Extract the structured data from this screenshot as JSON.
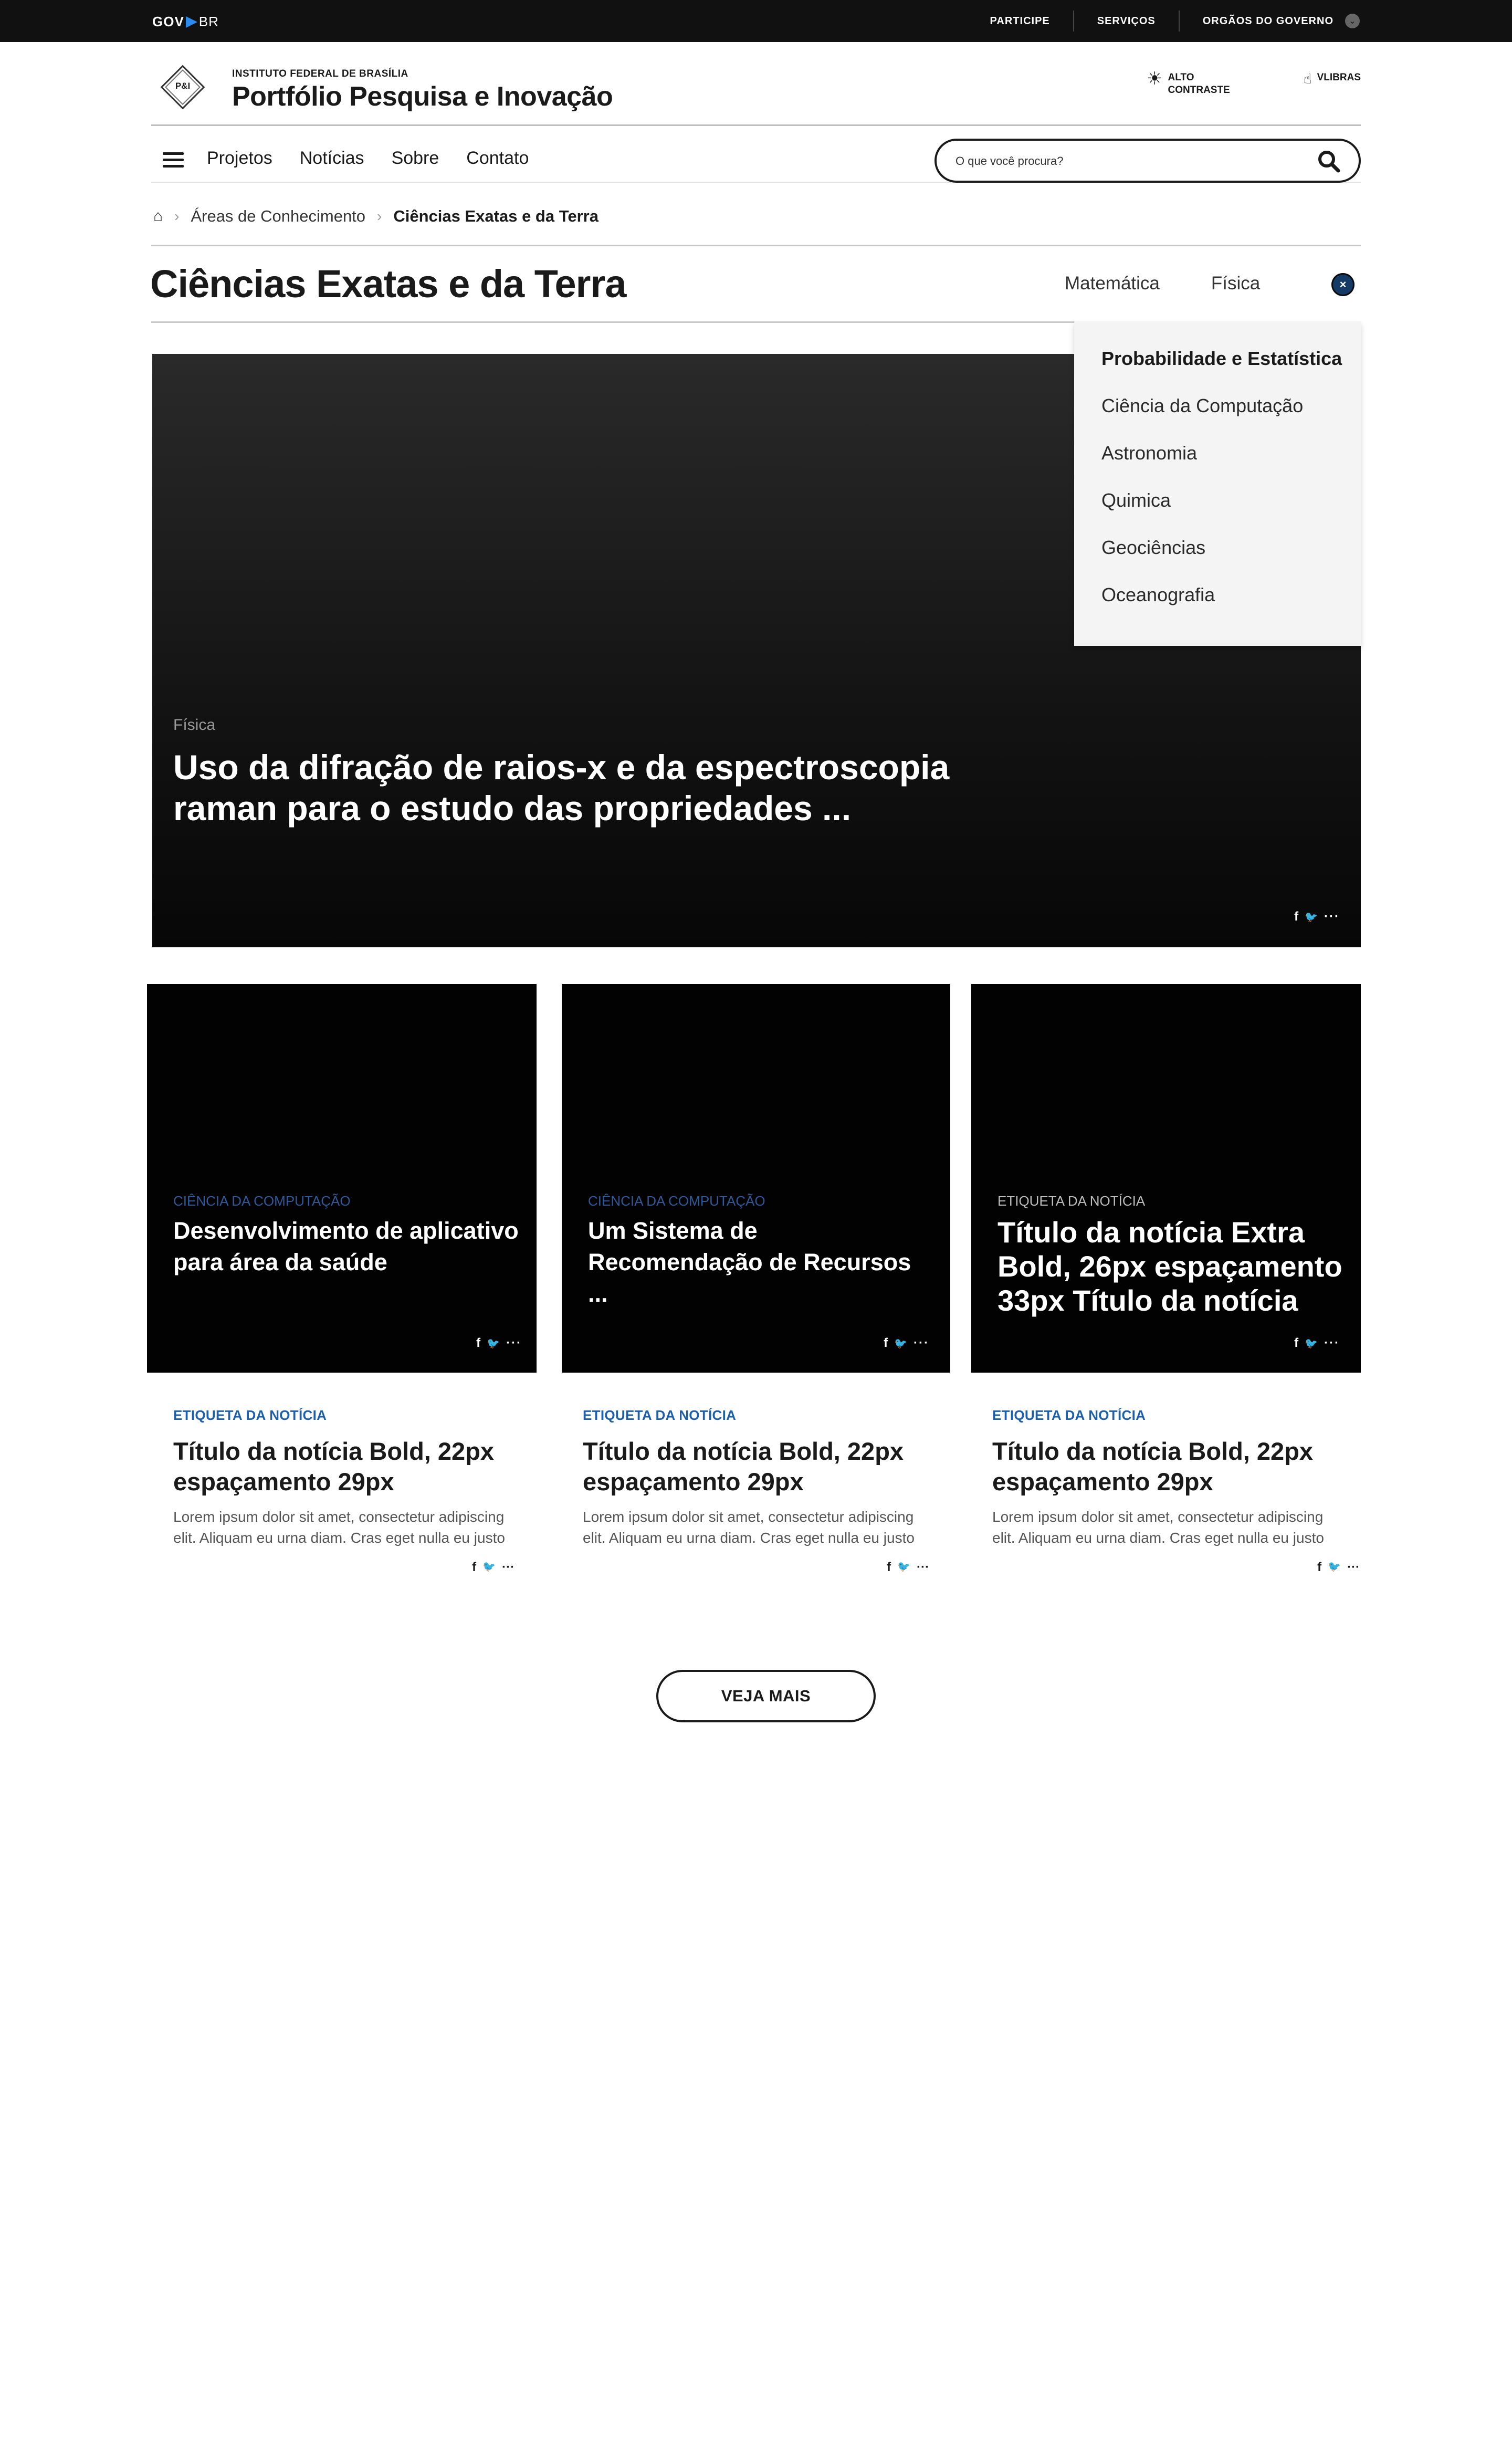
{
  "govbar": {
    "logo_gov": "GOV",
    "logo_br": "BR",
    "links": [
      "PARTICIPE",
      "SERVIÇOS",
      "ORGÃOS DO GOVERNO"
    ]
  },
  "header": {
    "brand_mark": "P&I",
    "subtitle": "INSTITUTO FEDERAL DE BRASÍLIA",
    "title": "Portfólio Pesquisa e Inovação",
    "contrast_label_1": "ALTO",
    "contrast_label_2": "CONTRASTE",
    "vlibras_label": "VLIBRAS"
  },
  "nav": {
    "items": [
      "Projetos",
      "Notícias",
      "Sobre",
      "Contato"
    ],
    "search_placeholder": "O que você procura?"
  },
  "breadcrumb": {
    "items": [
      "Áreas de Conhecimento",
      "Ciências Exatas e da Terra"
    ]
  },
  "page": {
    "title": "Ciências Exatas e da Terra",
    "subnav": [
      "Matemática",
      "Física"
    ],
    "close_icon": "×",
    "dropdown": [
      "Probabilidade e Estatística",
      "Ciência da Computação",
      "Astronomia",
      "Quimica",
      "Geociências",
      "Oceanografia"
    ]
  },
  "hero": {
    "tag": "Física",
    "title": "Uso da difração de raios-x e da espectroscopia raman para o estudo das propriedades ..."
  },
  "share_icons": {
    "facebook": "f",
    "twitter": "🐦",
    "more": "···"
  },
  "image_cards": [
    {
      "tag": "CIÊNCIA DA COMPUTAÇÃO",
      "title": "Desenvolvimento de aplicativo para área da saúde"
    },
    {
      "tag": "CIÊNCIA DA COMPUTAÇÃO",
      "title": "Um Sistema de Recomendação de Recursos ..."
    },
    {
      "tag": "ETIQUETA DA NOTÍCIA",
      "title": "Título da notícia Extra Bold, 26px espaçamento 33px Título da notícia"
    }
  ],
  "text_cards": [
    {
      "tag": "ETIQUETA DA NOTÍCIA",
      "title": "Título da notícia Bold, 22px espaçamento 29px",
      "body": "Lorem ipsum dolor sit amet, consectetur adipiscing elit. Aliquam eu urna diam. Cras eget nulla eu justo"
    },
    {
      "tag": "ETIQUETA DA NOTÍCIA",
      "title": "Título da notícia Bold, 22px espaçamento 29px",
      "body": "Lorem ipsum dolor sit amet, consectetur adipiscing elit. Aliquam eu urna diam. Cras eget nulla eu justo"
    },
    {
      "tag": "ETIQUETA DA NOTÍCIA",
      "title": "Título da notícia Bold, 22px espaçamento 29px",
      "body": "Lorem ipsum dolor sit amet, consectetur adipiscing elit. Aliquam eu urna diam. Cras eget nulla eu justo"
    }
  ],
  "more_button": "VEJA MAIS",
  "colors": {
    "tag_blue": "#1b5fad",
    "tag_blue_dark": "#2d5a9c",
    "govbar_bg": "#111111"
  }
}
